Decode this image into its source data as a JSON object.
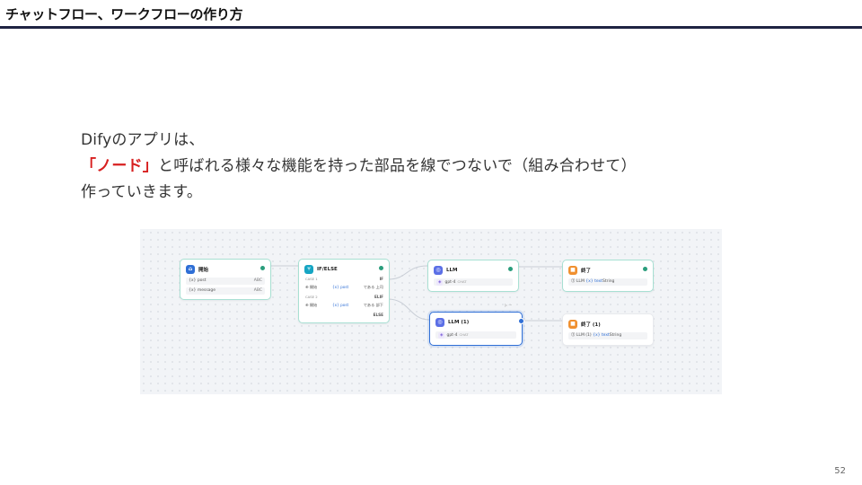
{
  "header": {
    "title": "チャットフロー、ワークフローの作り方"
  },
  "intro": {
    "line1": "Difyのアプリは、",
    "highlight": "「ノード」",
    "line2_rest": "と呼ばれる様々な機能を持った部品を線でつないで（組み合わせて）",
    "line3": "作っていきます。"
  },
  "canvas": {
    "start": {
      "title": "開始",
      "vars": [
        {
          "name": "{x} post",
          "type": "ABC"
        },
        {
          "name": "{x} message",
          "type": "ABC"
        }
      ]
    },
    "ifelse": {
      "title": "IF/ELSE",
      "case1": {
        "label": "CASE 1",
        "branch": "IF",
        "var": "⊕ 開始",
        "field": "{x} post",
        "op": "である 上司"
      },
      "case2": {
        "label": "CASE 2",
        "branch": "ELIF",
        "var": "⊕ 開始",
        "field": "{x} post",
        "op": "である 部下"
      },
      "else": "ELSE"
    },
    "llm": {
      "title": "LLM",
      "model": "gpt-4",
      "mode": "CHAT"
    },
    "llm2": {
      "title": "LLM (1)",
      "model": "gpt-4",
      "mode": "CHAT",
      "toolbar": "▷  ···"
    },
    "end1": {
      "title": "終了",
      "output_src": "⓵ LLM",
      "output_var": "{x} text",
      "output_type": "String"
    },
    "end2": {
      "title": "終了 (1)",
      "output_src": "⓵ LLM (1)",
      "output_var": "{x} text",
      "output_type": "String"
    }
  },
  "page": {
    "number": "52"
  }
}
